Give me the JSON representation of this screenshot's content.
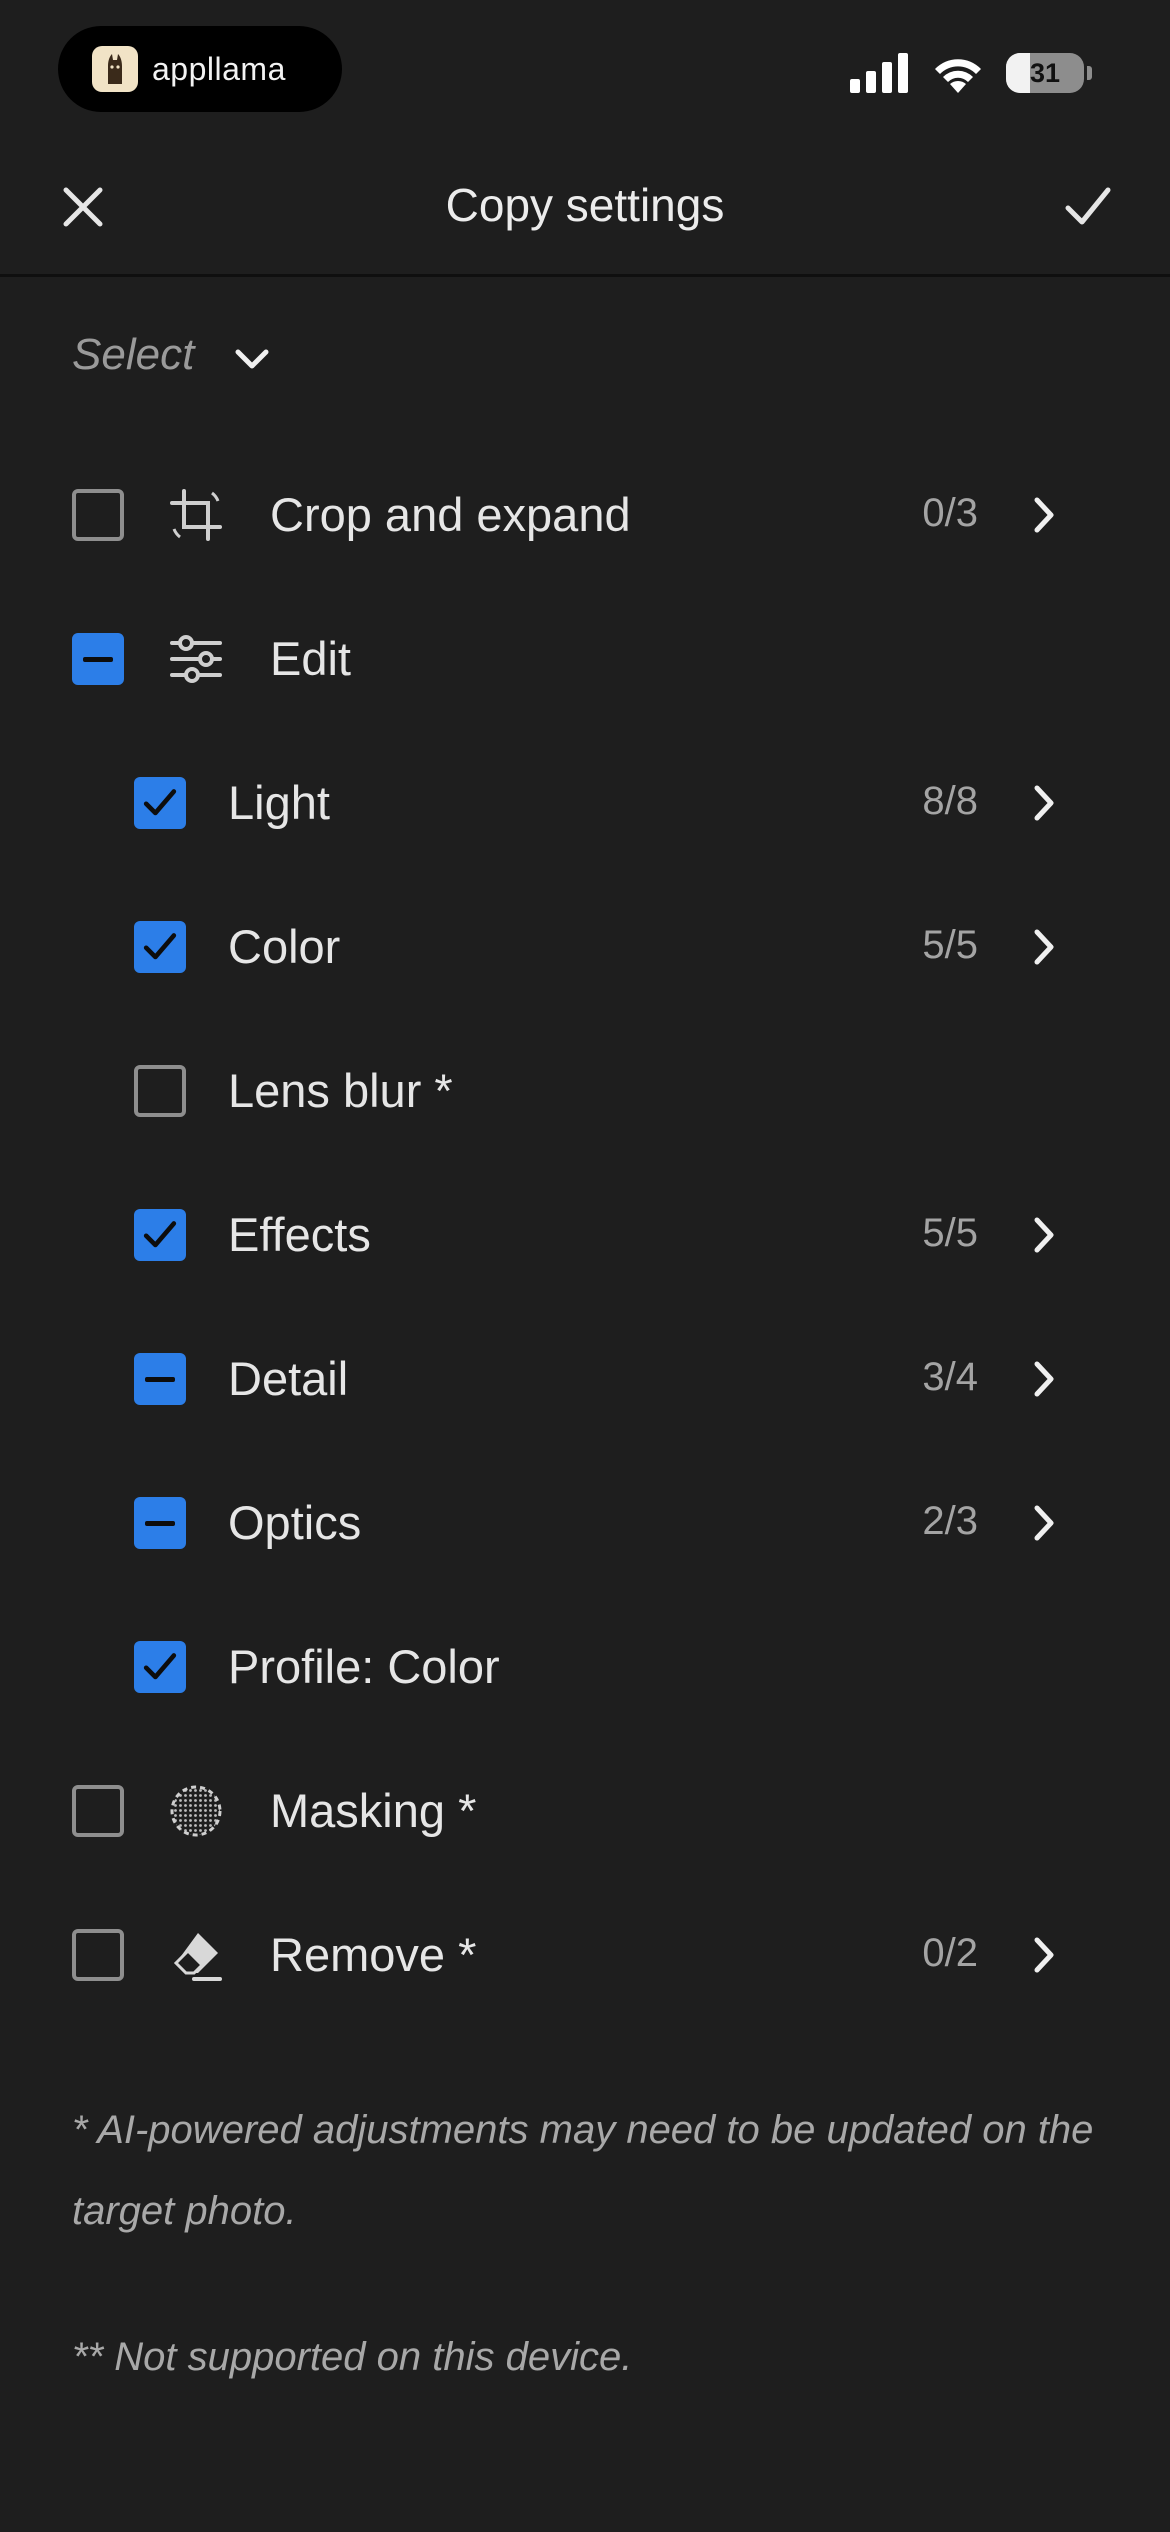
{
  "status_bar": {
    "brand_name": "appllama",
    "battery_level": "31",
    "battery_fraction": 0.31
  },
  "header": {
    "title": "Copy settings",
    "close_icon": "close-icon",
    "confirm_icon": "checkmark-icon"
  },
  "select": {
    "label": "Select",
    "icon": "chevron-down-icon"
  },
  "rows": [
    {
      "label": "Crop and expand",
      "count": "0/3",
      "state": "unchecked",
      "level": 0,
      "icon": "crop-icon",
      "chevron": true
    },
    {
      "label": "Edit",
      "count": "",
      "state": "mixed",
      "level": 0,
      "icon": "sliders-icon",
      "chevron": false
    },
    {
      "label": "Light",
      "count": "8/8",
      "state": "checked",
      "level": 1,
      "chevron": true
    },
    {
      "label": "Color",
      "count": "5/5",
      "state": "checked",
      "level": 1,
      "chevron": true
    },
    {
      "label": "Lens blur *",
      "count": "",
      "state": "unchecked",
      "level": 1,
      "chevron": false
    },
    {
      "label": "Effects",
      "count": "5/5",
      "state": "checked",
      "level": 1,
      "chevron": true
    },
    {
      "label": "Detail",
      "count": "3/4",
      "state": "mixed",
      "level": 1,
      "chevron": true
    },
    {
      "label": "Optics",
      "count": "2/3",
      "state": "mixed",
      "level": 1,
      "chevron": true
    },
    {
      "label": "Profile: Color",
      "count": "",
      "state": "checked",
      "level": 1,
      "chevron": false
    },
    {
      "label": "Masking *",
      "count": "",
      "state": "unchecked",
      "level": 0,
      "icon": "masking-icon",
      "chevron": false
    },
    {
      "label": "Remove *",
      "count": "0/2",
      "state": "unchecked",
      "level": 0,
      "icon": "eraser-icon",
      "chevron": true
    }
  ],
  "footnotes": {
    "ai_note": "* AI-powered adjustments may need to be updated on the target photo.",
    "device_note": "** Not supported on this device."
  },
  "colors": {
    "background": "#1e1e1e",
    "accent": "#2c7ee8",
    "text": "#e6e6e6",
    "muted": "#a4a4a4"
  }
}
